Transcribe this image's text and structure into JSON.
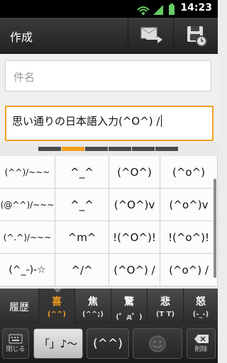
{
  "status": {
    "time": "14:23"
  },
  "actionbar": {
    "title": "作成"
  },
  "form": {
    "subject_placeholder": "件名",
    "body_text": "思い通りの日本語入力(^O^) /"
  },
  "emoticons": [
    [
      "(^^)/~~~",
      "^_^",
      "(^O^)",
      "(^o^)"
    ],
    [
      "(@^^)/~~~",
      "^_^",
      "(^O^)v",
      "(^o^)v"
    ],
    [
      "(^.^)/~~~",
      "^m^",
      "!(^O^)!",
      "!(^o^)!"
    ],
    [
      "(^_-)-☆",
      "^/^",
      "(^O^) /",
      "(^o^) /"
    ]
  ],
  "categories": [
    {
      "label": "履歴",
      "emoticon": ""
    },
    {
      "label": "喜",
      "emoticon": "(^^)"
    },
    {
      "label": "焦",
      "emoticon": "(^^;)"
    },
    {
      "label": "驚",
      "emoticon": "(゜д゜)"
    },
    {
      "label": "悲",
      "emoticon": "(T T)"
    },
    {
      "label": "怒",
      "emoticon": "(-_-)"
    }
  ],
  "bottom": {
    "close_label": "閉じる",
    "symbol_label": "「」♪～",
    "emoticon_label": "(^^)",
    "delete_label": "削除"
  },
  "colors": {
    "accent": "#f29d1c",
    "focus": "#f2a11f"
  }
}
